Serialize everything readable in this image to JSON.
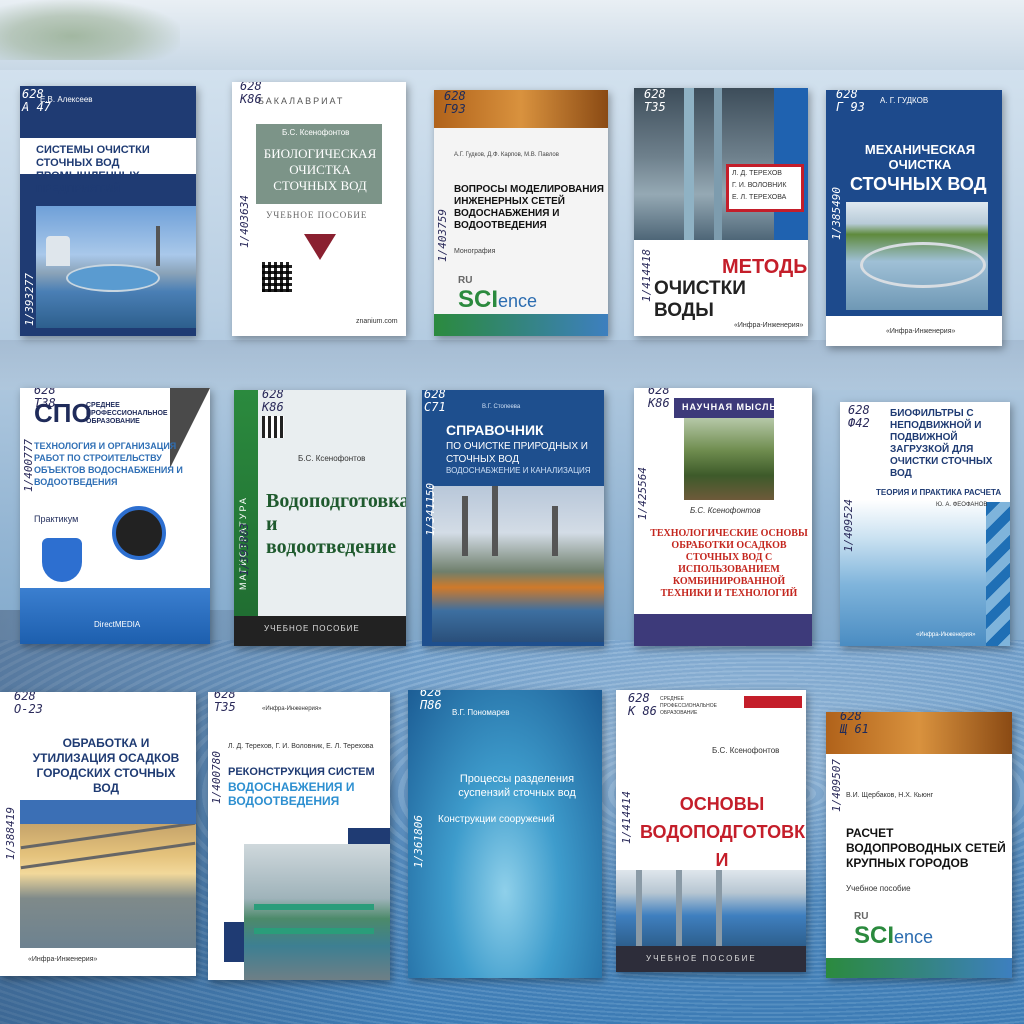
{
  "books": [
    {
      "call": "628\nА 47",
      "inv": "1/393277",
      "author": "Е.В. Алексеев",
      "title": "СИСТЕМЫ ОЧИСТКИ СТОЧНЫХ ВОД ПРОМЫШЛЕННЫХ ПРЕДПРИЯТИЙ"
    },
    {
      "call": "628\nК86",
      "inv": "1/403634",
      "series": "БАКАЛАВРИАТ",
      "author": "Б.С. Ксенофонтов",
      "title": "БИОЛОГИЧЕСКАЯ ОЧИСТКА СТОЧНЫХ ВОД",
      "subtitle": "УЧЕБНОЕ ПОСОБИЕ",
      "publisher": "znanium.com"
    },
    {
      "call": "628\nГ93",
      "inv": "1/403759",
      "author": "А.Г. Гудков, Д.Ф. Карпов, М.В. Павлов",
      "title": "ВОПРОСЫ МОДЕЛИРОВАНИЯ ИНЖЕНЕРНЫХ СЕТЕЙ ВОДОСНАБЖЕНИЯ И ВОДООТВЕДЕНИЯ",
      "genre": "Монография",
      "logo_ru": "RU",
      "logo": "SCI",
      "logo_e": "ence"
    },
    {
      "call": "628\nТ35",
      "inv": "1/414418",
      "author1": "Л. Д. ТЕРЕХОВ",
      "author2": "Г. И. ВОЛОВНИК",
      "author3": "Е. Л. ТЕРЕХОВА",
      "title1": "МЕТОДЫ",
      "title2": "ОЧИСТКИ ВОДЫ",
      "publisher": "«Инфра-Инженерия»"
    },
    {
      "call": "628\nГ 93",
      "inv": "1/385490",
      "author": "А. Г. ГУДКОВ",
      "title1": "МЕХАНИЧЕСКАЯ ОЧИСТКА",
      "title2": "СТОЧНЫХ ВОД",
      "publisher": "«Инфра-Инженерия»"
    },
    {
      "call": "628\nТ38",
      "inv": "1/400777",
      "brand": "СПО",
      "brand_sub": "СРЕДНЕЕ ПРОФЕССИОНАЛЬНОЕ ОБРАЗОВАНИЕ",
      "title": "ТЕХНОЛОГИЯ И ОРГАНИЗАЦИЯ РАБОТ ПО СТРОИТЕЛЬСТВУ ОБЪЕКТОВ ВОДОСНАБЖЕНИЯ И ВОДООТВЕДЕНИЯ",
      "genre": "Практикум",
      "publisher": "DirectMEDIA"
    },
    {
      "call": "628\nК86",
      "inv": "1/393803",
      "series": "МАГИСТРАТУРА",
      "author": "Б.С. Ксенофонтов",
      "title": "Водоподготовка и водоотведение",
      "subtitle": "УЧЕБНОЕ ПОСОБИЕ"
    },
    {
      "call": "628\nС71",
      "inv": "1/341150",
      "author": "В.Г. Стопеева",
      "title": "СПРАВОЧНИК",
      "title2": "ПО ОЧИСТКЕ ПРИРОДНЫХ И СТОЧНЫХ ВОД",
      "subtitle": "ВОДОСНАБЖЕНИЕ И КАНАЛИЗАЦИЯ"
    },
    {
      "call": "628\nК86",
      "inv": "1/425564",
      "series": "НАУЧНАЯ МЫСЛЬ",
      "author": "Б.С. Ксенофонтов",
      "title": "ТЕХНОЛОГИЧЕСКИЕ ОСНОВЫ ОБРАБОТКИ ОСАДКОВ СТОЧНЫХ ВОД С ИСПОЛЬЗОВАНИЕМ КОМБИНИРОВАННОЙ ТЕХНИКИ И ТЕХНОЛОГИЙ"
    },
    {
      "call": "628\nФ42",
      "inv": "1/409524",
      "title": "БИОФИЛЬТРЫ С НЕПОДВИЖНОЙ И ПОДВИЖНОЙ ЗАГРУЗКОЙ ДЛЯ ОЧИСТКИ СТОЧНЫХ ВОД",
      "subtitle": "ТЕОРИЯ И ПРАКТИКА РАСЧЕТА",
      "author": "Ю. А. ФЕОФАНОВ",
      "publisher": "«Инфра-Инженерия»"
    },
    {
      "call": "628\nО-23",
      "inv": "1/388419",
      "title": "ОБРАБОТКА И УТИЛИЗАЦИЯ ОСАДКОВ ГОРОДСКИХ СТОЧНЫХ ВОД",
      "publisher": "«Инфра-Инженерия»"
    },
    {
      "call": "628\nТ35",
      "inv": "1/400780",
      "publisher": "«Инфра-Инженерия»",
      "author": "Л. Д. Терехов, Г. И. Воловник, Е. Л. Терехова",
      "title1": "РЕКОНСТРУКЦИЯ СИСТЕМ",
      "title2": "ВОДОСНАБЖЕНИЯ И ВОДООТВЕДЕНИЯ"
    },
    {
      "call": "628\nП86",
      "inv": "1/361806",
      "author": "В.Г. Пономарев",
      "title": "Процессы разделения суспензий сточных вод",
      "subtitle": "Конструкции сооружений"
    },
    {
      "call": "628\nК 86",
      "inv": "1/414414",
      "series": "СРЕДНЕЕ ПРОФЕССИОНАЛЬНОЕ ОБРАЗОВАНИЕ",
      "author": "Б.С. Ксенофонтов",
      "title": "ОСНОВЫ ВОДОПОДГОТОВКИ И ВОДООТВЕДЕНИЯ",
      "subtitle": "УЧЕБНОЕ ПОСОБИЕ"
    },
    {
      "call": "628\nЩ 61",
      "inv": "1/409507",
      "author": "В.И. Щербаков, Н.Х. Кьюнг",
      "title": "РАСЧЕТ ВОДОПРОВОДНЫХ СЕТЕЙ КРУПНЫХ ГОРОДОВ",
      "genre": "Учебное пособие",
      "logo_ru": "RU",
      "logo": "SCI",
      "logo_e": "ence"
    }
  ]
}
